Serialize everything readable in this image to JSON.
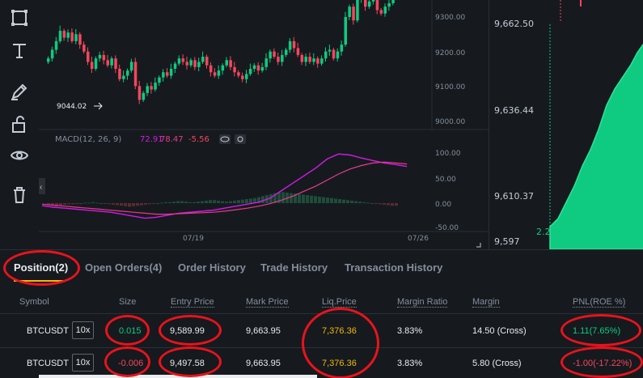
{
  "toolbar": {
    "icons": [
      "selection-box-icon",
      "text-icon",
      "pencil-ruler-icon",
      "unlock-icon",
      "eye-icon",
      "trash-icon"
    ]
  },
  "chart": {
    "price_ticks": [
      "9300.00",
      "9200.00",
      "9100.00",
      "9000.00"
    ],
    "low_marker": "9044.02",
    "macd_label": "MACD(12, 26, 9)",
    "macd_value": "72.91",
    "signal_value": "78.47",
    "hist_value": "-5.56",
    "macd_ticks": [
      "100.00",
      "50.00",
      "0.00",
      "-50.00"
    ],
    "x_ticks": [
      "07/19",
      "07/26"
    ]
  },
  "chart_data": {
    "type": "line",
    "title": "",
    "xlabel": "",
    "ylabel": "",
    "x": [
      "07/19",
      "07/26"
    ],
    "series": [
      {
        "name": "MACD",
        "values": [
          72.91
        ]
      },
      {
        "name": "Signal",
        "values": [
          78.47
        ]
      }
    ]
  },
  "depth": {
    "price_ticks": [
      "9,662.50",
      "9,636.44",
      "9,610.37",
      "9,597"
    ],
    "volume_label": "2.25K"
  },
  "tabs": [
    {
      "label": "Position(2)",
      "active": true
    },
    {
      "label": "Open Orders(4)",
      "active": false
    },
    {
      "label": "Order History",
      "active": false
    },
    {
      "label": "Trade History",
      "active": false
    },
    {
      "label": "Transaction History",
      "active": false
    }
  ],
  "table": {
    "headers": {
      "symbol": "Symbol",
      "size": "Size",
      "entry_price": "Entry Price",
      "mark_price": "Mark Price",
      "liq_price": "Liq.Price",
      "margin_ratio": "Margin Ratio",
      "margin": "Margin",
      "pnl": "PNL(ROE %)"
    },
    "rows": [
      {
        "symbol": "BTCUSDT",
        "leverage": "10x",
        "size": "0.015",
        "entry_price": "9,589.99",
        "mark_price": "9,663.95",
        "liq_price": "7,376.36",
        "margin_ratio": "3.83%",
        "margin": "14.50 (Cross)",
        "pnl": "1.11(7.65%)"
      },
      {
        "symbol": "BTCUSDT",
        "leverage": "10x",
        "size": "-0.006",
        "entry_price": "9,497.58",
        "mark_price": "9,663.95",
        "liq_price": "7,376.36",
        "margin_ratio": "3.83%",
        "margin": "5.80 (Cross)",
        "pnl": "-1.00(-17.22%)"
      }
    ]
  },
  "colors": {
    "up": "#0ecb81",
    "down": "#f6465d",
    "accent": "#f0b90b",
    "macd_line": "#d21ae8",
    "signal_line": "#e83a8c",
    "annotation": "#e8131c"
  }
}
